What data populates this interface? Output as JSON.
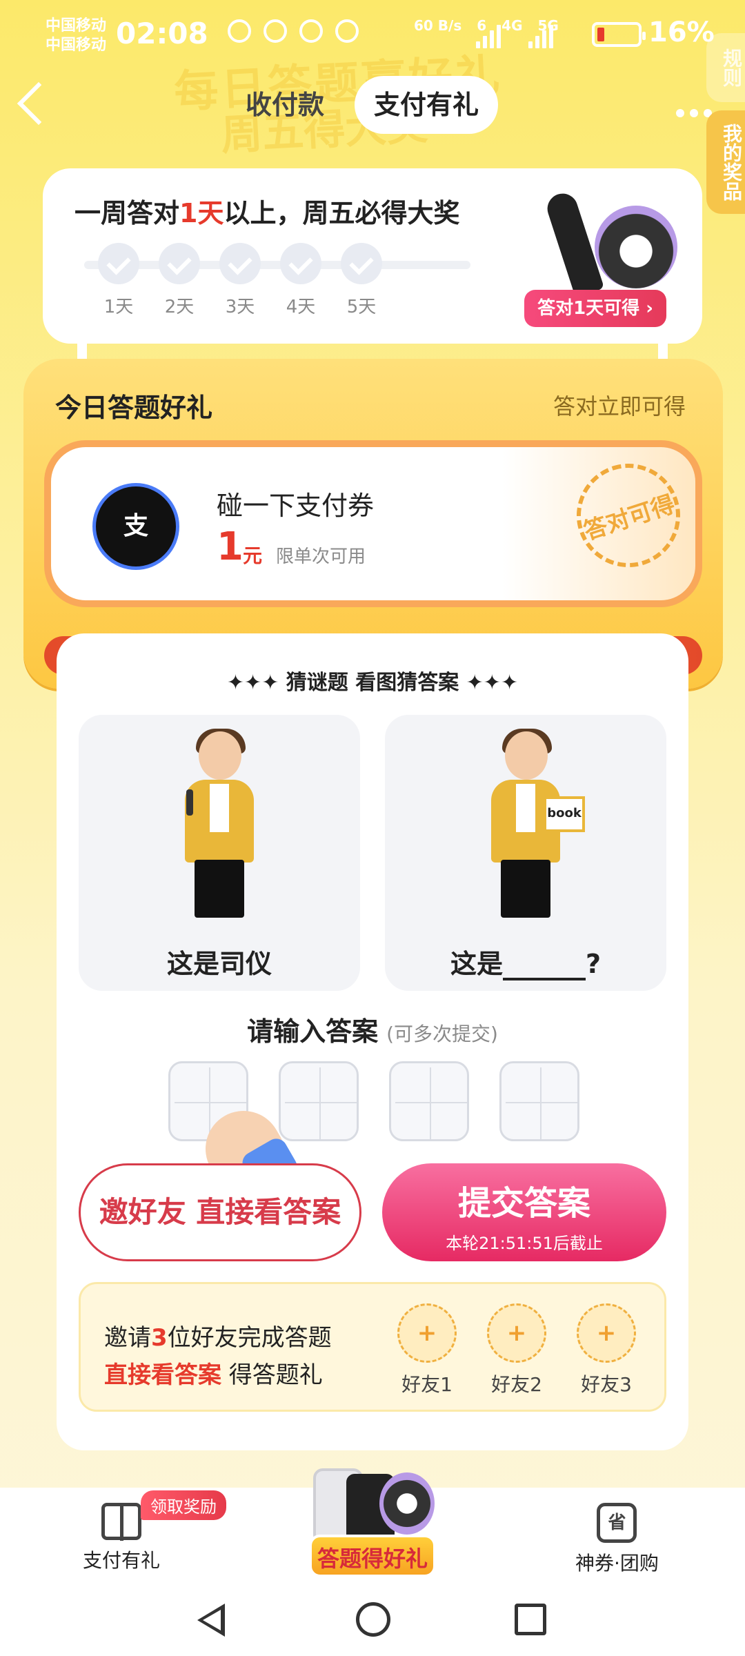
{
  "status_bar": {
    "carrier1": "中国移动",
    "carrier2": "中国移动",
    "time": "02:08",
    "net_speed": "60 B/s",
    "net_types": [
      "6",
      "4G",
      "5G"
    ],
    "battery": "16%"
  },
  "header": {
    "bg_title": "每日答题赢好礼",
    "bg_subtitle": "周五得大奖",
    "tabs": [
      {
        "label": "收付款",
        "active": false
      },
      {
        "label": "支付有礼",
        "active": true
      }
    ],
    "side_rules": "规则",
    "side_prizes": "我的奖品"
  },
  "weekly": {
    "title_pre": "一周答对",
    "title_hl": "1天",
    "title_post": "以上，周五必得大奖",
    "days": [
      "1天",
      "2天",
      "3天",
      "4天",
      "5天"
    ],
    "prize_button": "答对1天可得 ›"
  },
  "today_gift": {
    "title": "今日答题好礼",
    "subtitle": "答对立即可得",
    "coupon": {
      "logo_text": "支",
      "name": "碰一下支付券",
      "amount": "1",
      "unit": "元",
      "note": "限单次可用",
      "stamp": "答对可得"
    }
  },
  "quiz": {
    "title": "✦✦✦ 猜谜题 看图猜答案 ✦✦✦",
    "pictures": [
      {
        "caption": "这是司仪"
      },
      {
        "caption_pre": "这是",
        "caption_post": "?",
        "book_label": "book"
      }
    ],
    "input_title": "请输入答案",
    "input_note": "(可多次提交)",
    "invite_button": "邀好友 直接看答案",
    "submit_button": "提交答案",
    "submit_deadline": "本轮21:51:51后截止",
    "invite_panel": {
      "line1_pre": "邀请",
      "line1_hl": "3",
      "line1_post": "位好友完成答题",
      "line2_hl": "直接看答案",
      "line2_post": " 得答题礼",
      "friends": [
        "好友1",
        "好友2",
        "好友3"
      ],
      "plus": "+"
    }
  },
  "bottom_nav": {
    "left_label": "支付有礼",
    "left_badge": "领取奖励",
    "center_label": "答题得好礼",
    "right_label": "神券·团购",
    "right_icon_text": "省"
  }
}
